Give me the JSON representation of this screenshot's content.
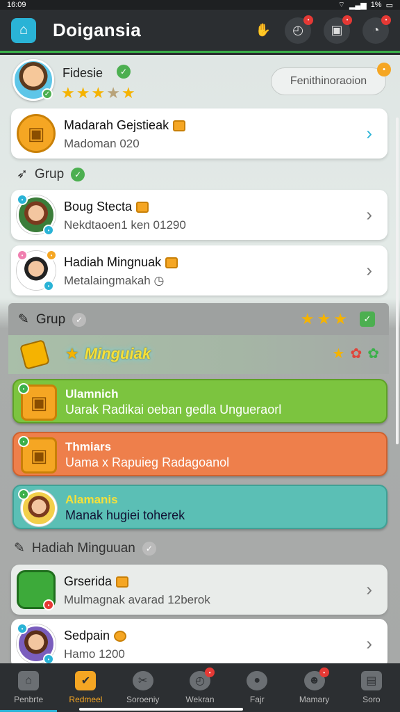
{
  "status_bar": {
    "time": "16:09",
    "battery": "1%"
  },
  "app_bar": {
    "title": "Doigansia"
  },
  "profile": {
    "name": "Fidesie",
    "button_label": "Fenithinoraoion"
  },
  "cards_top": [
    {
      "title": "Madarah Gejstieak",
      "subtitle": "Madoman 020"
    }
  ],
  "section_grup": {
    "label": "Grup"
  },
  "cards_grup": [
    {
      "title": "Boug Stecta",
      "subtitle": "Nekdtaoen1 ken 01290"
    },
    {
      "title": "Hadiah Mingnuak",
      "subtitle": "Metalaingmakah"
    }
  ],
  "group_band": {
    "label": "Grup"
  },
  "banner": {
    "label": "Minguiak"
  },
  "color_cards": [
    {
      "title": "Ulamnich",
      "subtitle": "Uarak Radikai oeban gedla Ungueraorl"
    },
    {
      "title": "Thmiars",
      "subtitle": "Uama x Rapuieg Radagoanol"
    },
    {
      "title": "Alamanis",
      "subtitle": "Manak hugiei toherek"
    }
  ],
  "section_hadiah": {
    "label": "Hadiah Minguuan"
  },
  "cards_bottom": [
    {
      "title": "Grserida",
      "subtitle": "Mulmagnak avarad 12berok"
    },
    {
      "title": "Sedpain",
      "subtitle": "Hamo 1200"
    }
  ],
  "bottom_nav": [
    {
      "label": "Penbrte"
    },
    {
      "label": "Redmeel"
    },
    {
      "label": "Soroeniy"
    },
    {
      "label": "Wekran"
    },
    {
      "label": "Fajr"
    },
    {
      "label": "Mamary"
    },
    {
      "label": "Soro"
    }
  ],
  "colors": {
    "accent": "#2ab3d6",
    "active_nav": "#f5a623",
    "verified": "#4caf50"
  }
}
